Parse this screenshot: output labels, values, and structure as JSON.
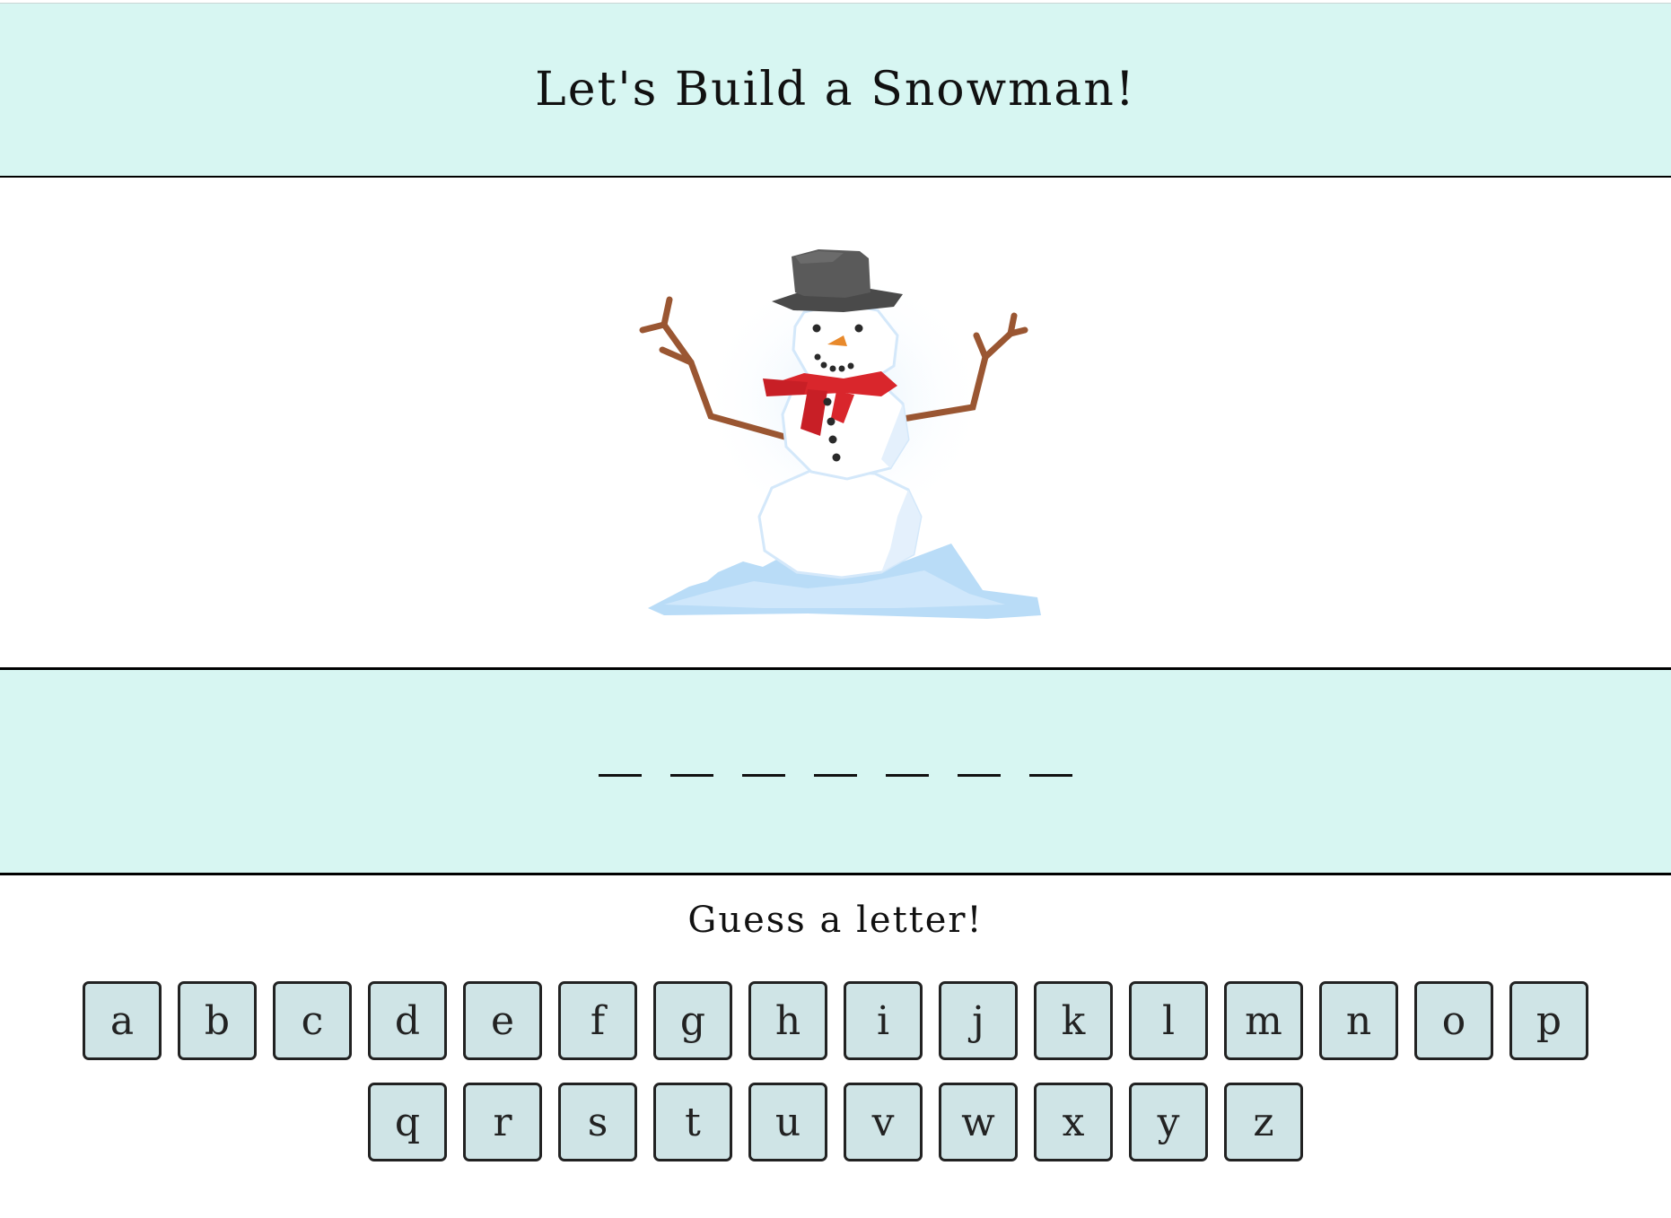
{
  "header": {
    "title": "Let's Build a Snowman!"
  },
  "word": {
    "blank_count": 7
  },
  "prompt": "Guess a letter!",
  "keyboard": {
    "row1": [
      "a",
      "b",
      "c",
      "d",
      "e",
      "f",
      "g",
      "h",
      "i",
      "j",
      "k",
      "l",
      "m",
      "n",
      "o",
      "p"
    ],
    "row2": [
      "q",
      "r",
      "s",
      "t",
      "u",
      "v",
      "w",
      "x",
      "y",
      "z"
    ]
  },
  "colors": {
    "panel_bg": "#d7f6f2",
    "key_bg": "#cfe4e6",
    "scarf": "#d9262c",
    "hat": "#545454",
    "carrot": "#e8892b",
    "arm": "#9a5632",
    "snow_ground": "#b9dcf7"
  },
  "icons": {
    "scene": "snowman-illustration"
  }
}
